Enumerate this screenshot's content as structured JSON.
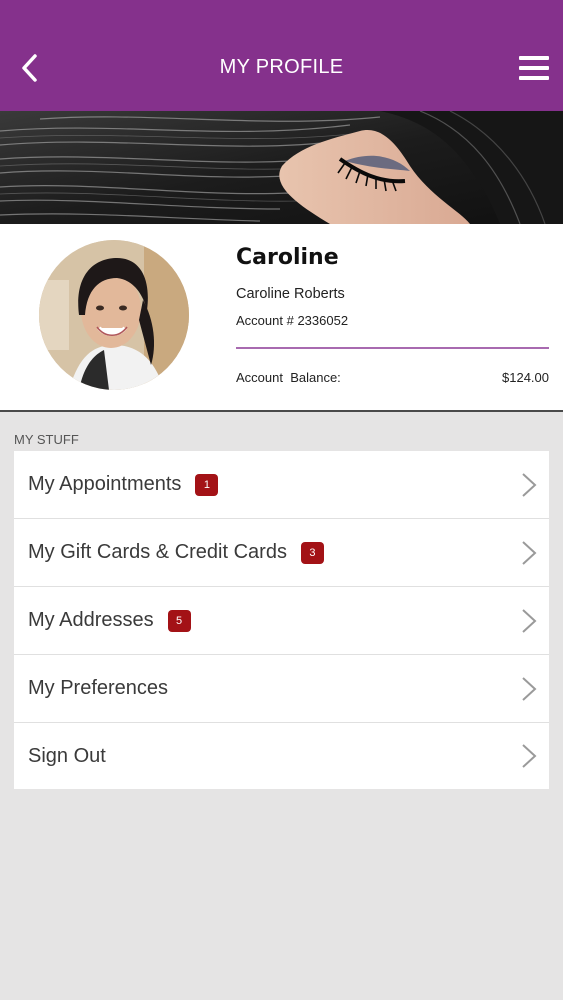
{
  "header": {
    "title": "MY PROFILE",
    "back_icon": "chevron-left-icon",
    "menu_icon": "hamburger-menu-icon",
    "background": "#85318c"
  },
  "profile": {
    "first_name": "Caroline",
    "full_name": "Caroline Roberts",
    "account_label": "Account",
    "account_number": "# 2336052",
    "balance_label": "Account  Balance:",
    "balance_value": "$124.00",
    "accent": "#a86ab0"
  },
  "my_stuff": {
    "heading": "MY STUFF",
    "items": [
      {
        "label": "My Appointments",
        "badge": "1"
      },
      {
        "label": "My Gift Cards & Credit Cards",
        "badge": "3"
      },
      {
        "label": "My Addresses",
        "badge": "5"
      },
      {
        "label": "My Preferences",
        "badge": null
      },
      {
        "label": "Sign Out",
        "badge": null
      }
    ],
    "badge_color": "#a31216"
  }
}
